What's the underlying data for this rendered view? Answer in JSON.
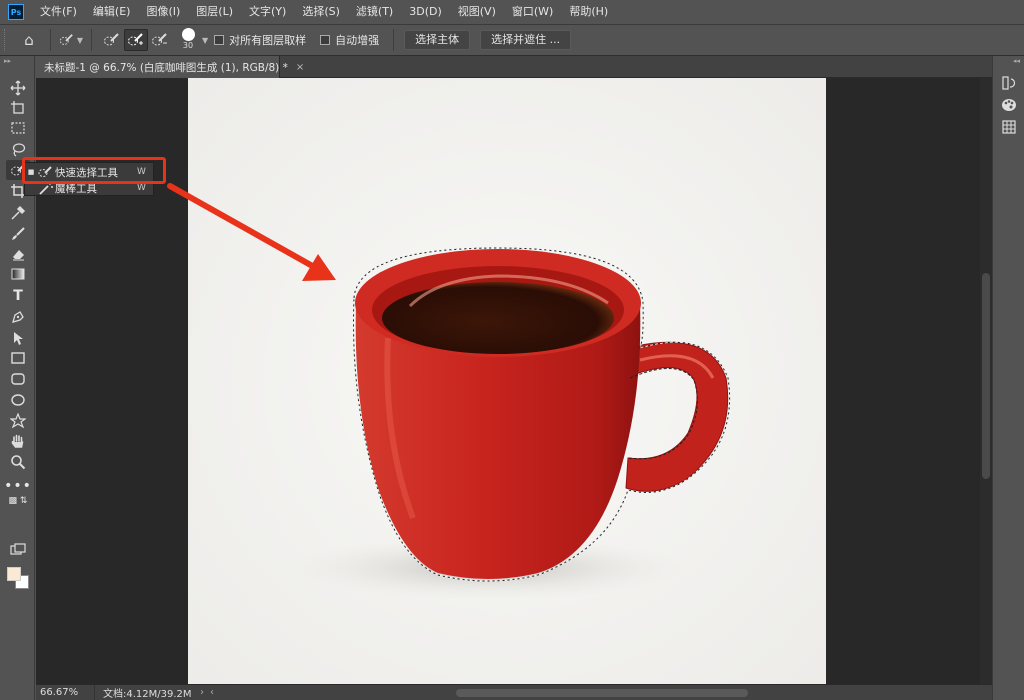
{
  "app": {
    "logo": "Ps",
    "menu": [
      "文件(F)",
      "编辑(E)",
      "图像(I)",
      "图层(L)",
      "文字(Y)",
      "选择(S)",
      "滤镜(T)",
      "3D(D)",
      "视图(V)",
      "窗口(W)",
      "帮助(H)"
    ]
  },
  "options_bar": {
    "brush_size": "30",
    "sample_all_layers": "对所有图层取样",
    "auto_enhance": "自动增强",
    "select_subject": "选择主体",
    "select_and_mask": "选择并遮住 ..."
  },
  "document": {
    "tab_title": "未标题-1 @ 66.7% (白底咖啡图生成 (1), RGB/8) *",
    "close_glyph": "×"
  },
  "flyout": {
    "items": [
      {
        "label": "快速选择工具",
        "shortcut": "W",
        "selected": true
      },
      {
        "label": "魔棒工具",
        "shortcut": "W",
        "selected": false
      }
    ]
  },
  "status": {
    "zoom": "66.67%",
    "doc_info": "文档:4.12M/39.2M"
  },
  "colors": {
    "foreground": "#fbe9d4",
    "background": "#ffffff",
    "annotation": "#e8321a",
    "mug": "#c8241e"
  }
}
